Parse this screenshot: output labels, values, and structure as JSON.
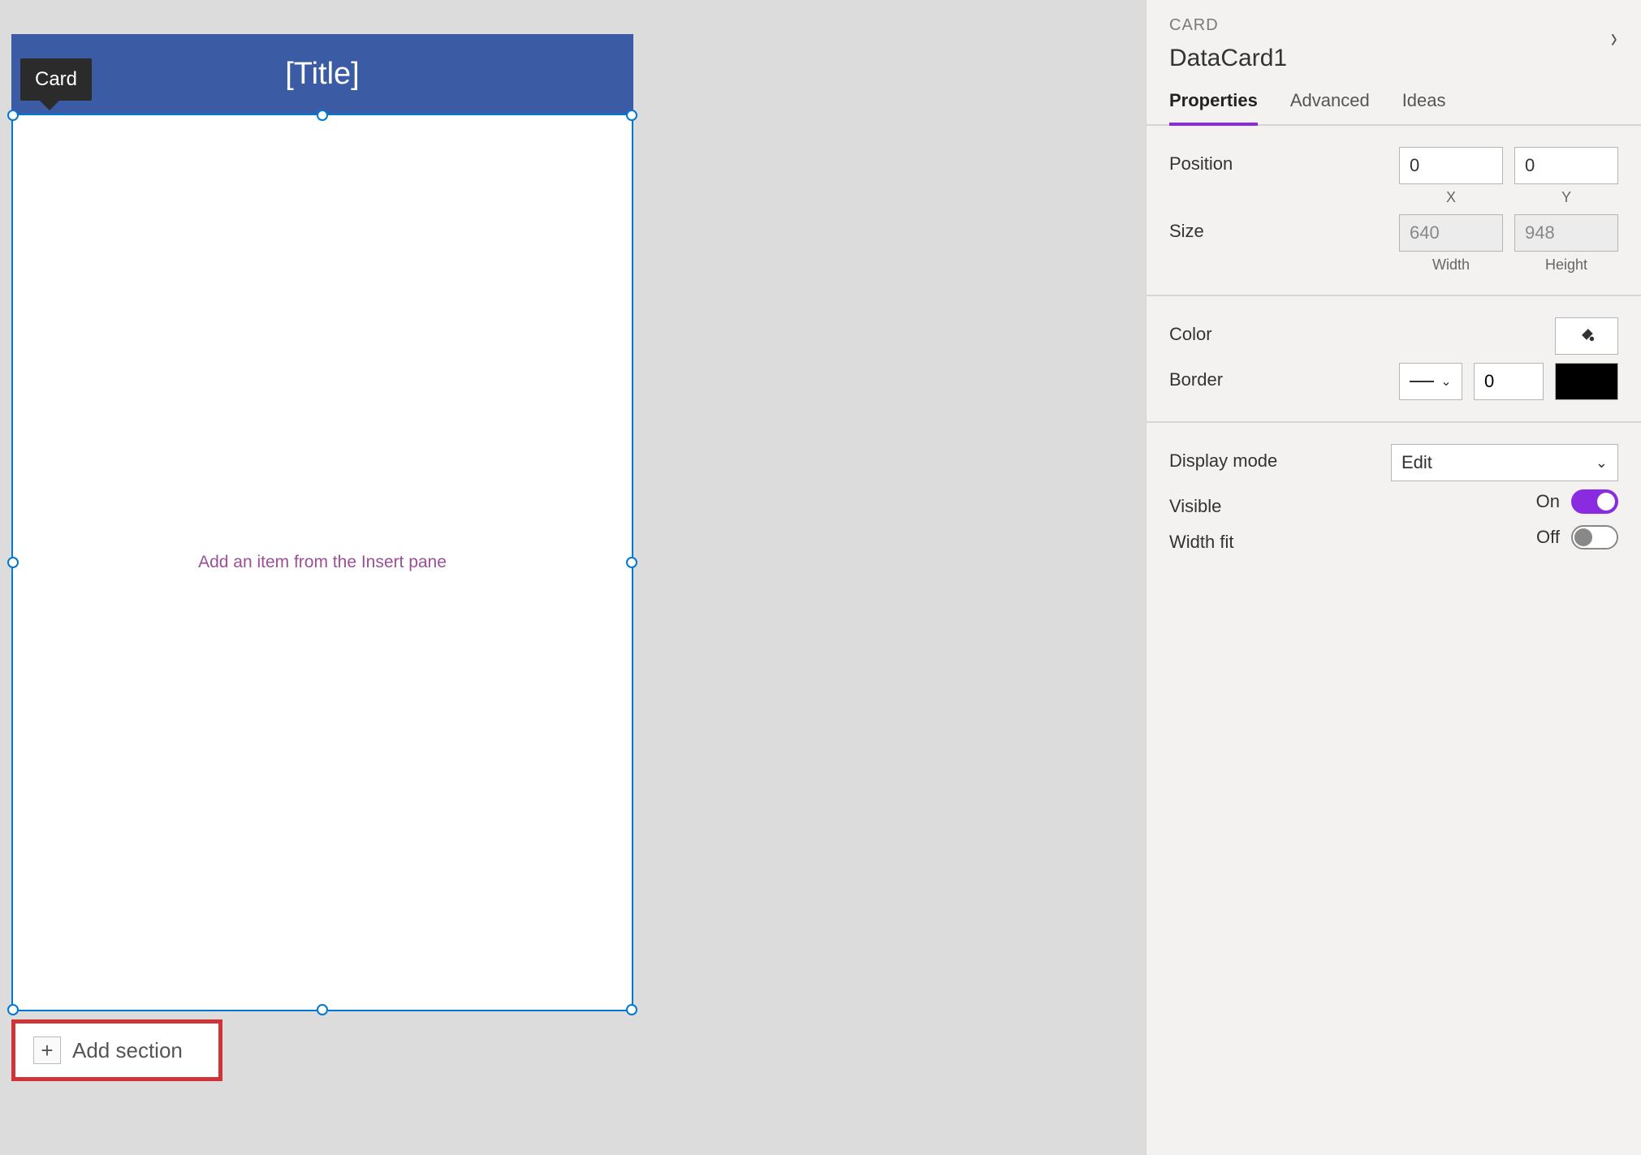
{
  "canvas": {
    "tag_label": "Card",
    "title": "[Title]",
    "placeholder": "Add an item from the Insert pane",
    "add_section_label": "Add section"
  },
  "pane": {
    "category": "CARD",
    "name": "DataCard1",
    "tabs": {
      "properties": "Properties",
      "advanced": "Advanced",
      "ideas": "Ideas"
    },
    "position": {
      "label": "Position",
      "x": "0",
      "y": "0",
      "x_label": "X",
      "y_label": "Y"
    },
    "size": {
      "label": "Size",
      "width": "640",
      "height": "948",
      "width_label": "Width",
      "height_label": "Height"
    },
    "color": {
      "label": "Color"
    },
    "border": {
      "label": "Border",
      "width": "0"
    },
    "display_mode": {
      "label": "Display mode",
      "value": "Edit"
    },
    "visible": {
      "label": "Visible",
      "state": "On"
    },
    "width_fit": {
      "label": "Width fit",
      "state": "Off"
    }
  }
}
